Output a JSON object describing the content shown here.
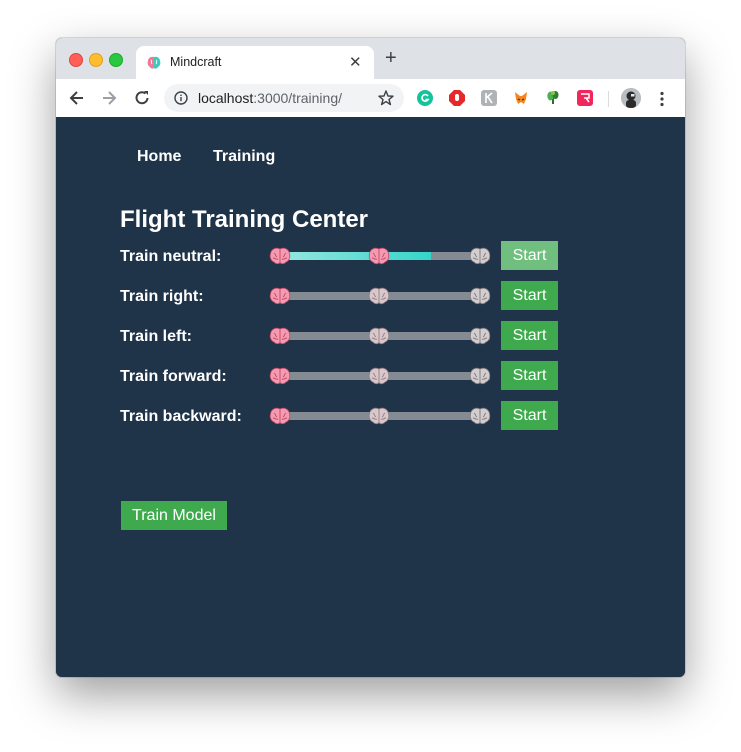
{
  "browser": {
    "tab_title": "Mindcraft",
    "tab_close": "✕",
    "new_tab": "+",
    "url_host": "localhost",
    "url_rest": ":3000/training/",
    "extensions": [
      "grammarly-icon",
      "adblock-icon",
      "rk-icon",
      "metamask-icon",
      "plant-icon",
      "pink-ext-icon"
    ],
    "colors": {
      "tab_strip": "#dee1e6",
      "toolbar": "#ffffff"
    }
  },
  "nav": {
    "home": "Home",
    "training": "Training"
  },
  "page": {
    "title": "Flight Training Center",
    "rows": [
      {
        "label": "Train neutral:",
        "button": "Start",
        "progress": 0.72,
        "button_state": "disabled"
      },
      {
        "label": "Train right:",
        "button": "Start",
        "progress": 0,
        "button_state": "enabled"
      },
      {
        "label": "Train left:",
        "button": "Start",
        "progress": 0,
        "button_state": "enabled"
      },
      {
        "label": "Train forward:",
        "button": "Start",
        "progress": 0,
        "button_state": "enabled"
      },
      {
        "label": "Train backward:",
        "button": "Start",
        "progress": 0,
        "button_state": "enabled"
      }
    ],
    "train_model": "Train Model",
    "colors": {
      "background": "#1f3349",
      "button": "#3faa4d",
      "progress": "#34d5ca"
    }
  }
}
